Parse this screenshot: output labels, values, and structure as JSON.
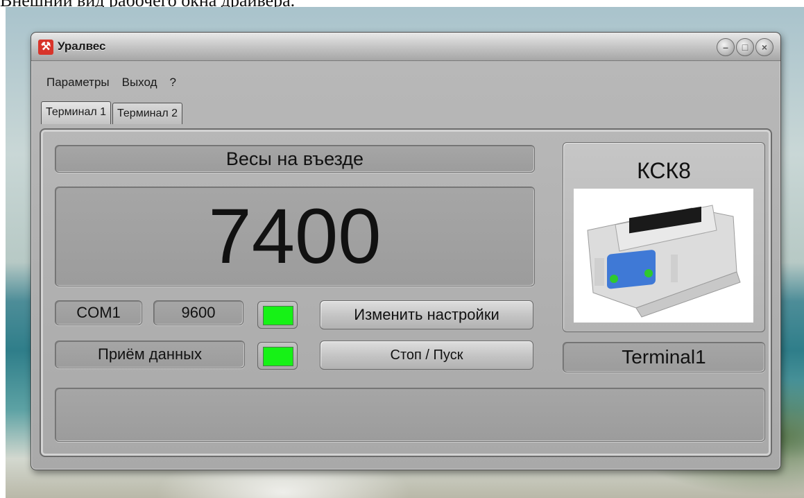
{
  "document_caption": "Внешний вид рабочего окна драйвера.",
  "window": {
    "title": "Уралвес",
    "app_icon": "hammer-tools-icon",
    "controls": [
      {
        "icon": "minimize-icon",
        "glyph": "–"
      },
      {
        "icon": "maximize-icon",
        "glyph": "□"
      },
      {
        "icon": "close-icon",
        "glyph": "×"
      }
    ]
  },
  "menu": [
    "Параметры",
    "Выход",
    "?"
  ],
  "tabs": [
    {
      "label": "Терминал 1",
      "active": true
    },
    {
      "label": "Терминал 2",
      "active": false
    }
  ],
  "scale": {
    "name": "Весы на въезде",
    "weight": "7400"
  },
  "connection": {
    "port": "COM1",
    "baud": "9600",
    "status_led_color": "#16f216",
    "change_settings_label": "Изменить настройки",
    "rx_label": "Приём данных",
    "rx_led_color": "#16f216",
    "stop_start_label": "Стоп / Пуск"
  },
  "device": {
    "model": "КСК8",
    "terminal_name": "Terminal1",
    "photo_icon": "weighing-terminal-image"
  },
  "message_area": ""
}
